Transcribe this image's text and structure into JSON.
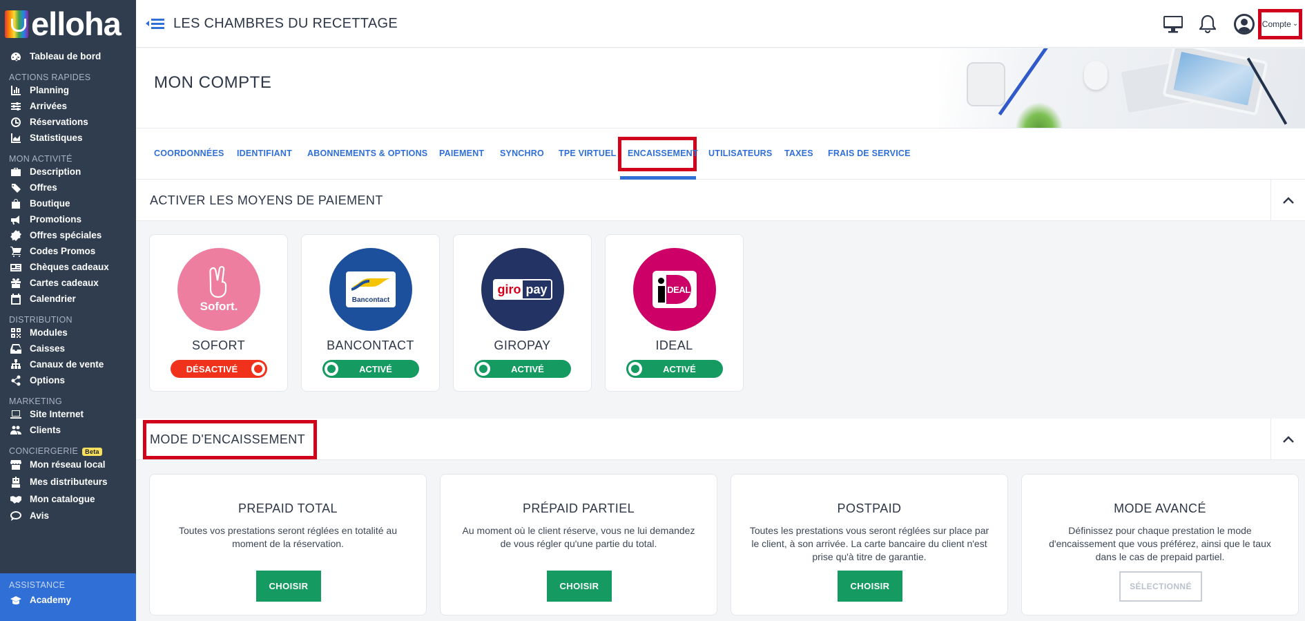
{
  "brand": {
    "logo_text": "elloha"
  },
  "topbar": {
    "hotel_name": "LES CHAMBRES DU RECETTAGE",
    "account_label": "Compte"
  },
  "sidebar": {
    "dashboard": "Tableau de bord",
    "sections": [
      {
        "title": "ACTIONS RAPIDES",
        "items": [
          {
            "label": "Planning",
            "icon": "bar-chart-icon"
          },
          {
            "label": "Arrivées",
            "icon": "sliders-icon"
          },
          {
            "label": "Réservations",
            "icon": "clock-icon"
          },
          {
            "label": "Statistiques",
            "icon": "area-chart-icon"
          }
        ]
      },
      {
        "title": "MON ACTIVITÉ",
        "items": [
          {
            "label": "Description",
            "icon": "briefcase-icon"
          },
          {
            "label": "Offres",
            "icon": "tags-icon"
          },
          {
            "label": "Boutique",
            "icon": "shopping-bag-icon"
          },
          {
            "label": "Promotions",
            "icon": "megaphone-icon"
          },
          {
            "label": "Offres spéciales",
            "icon": "badge-icon"
          },
          {
            "label": "Codes Promos",
            "icon": "cart-icon"
          },
          {
            "label": "Chèques cadeaux",
            "icon": "newspaper-icon"
          },
          {
            "label": "Cartes cadeaux",
            "icon": "gift-icon"
          },
          {
            "label": "Calendrier",
            "icon": "calendar-icon"
          }
        ]
      },
      {
        "title": "DISTRIBUTION",
        "items": [
          {
            "label": "Modules",
            "icon": "qrcode-icon"
          },
          {
            "label": "Caisses",
            "icon": "inbox-icon"
          },
          {
            "label": "Canaux de vente",
            "icon": "sitemap-icon"
          },
          {
            "label": "Options",
            "icon": "share-icon"
          }
        ]
      },
      {
        "title": "MARKETING",
        "items": [
          {
            "label": "Site Internet",
            "icon": "laptop-icon"
          },
          {
            "label": "Clients",
            "icon": "users-icon"
          }
        ]
      },
      {
        "title": "CONCIERGERIE",
        "badge": "Beta",
        "items": [
          {
            "label": "Mon réseau local",
            "icon": "store-icon"
          },
          {
            "label": "Mes distributeurs",
            "icon": "robot-icon"
          },
          {
            "label": "Mon catalogue",
            "icon": "handshake-icon"
          },
          {
            "label": "Avis",
            "icon": "comment-icon"
          }
        ]
      }
    ],
    "assistance": {
      "title": "ASSISTANCE",
      "item": "Academy"
    }
  },
  "page": {
    "title": "MON COMPTE"
  },
  "tabs": [
    "COORDONNÉES",
    "IDENTIFIANT",
    "ABONNEMENTS & OPTIONS",
    "PAIEMENT",
    "SYNCHRO",
    "TPE VIRTUEL",
    "ENCAISSEMENT",
    "UTILISATEURS",
    "TAXES",
    "FRAIS DE SERVICE"
  ],
  "active_tab": "ENCAISSEMENT",
  "payment_section": {
    "title": "ACTIVER LES MOYENS DE PAIEMENT",
    "methods": [
      {
        "name": "SOFORT",
        "logo_text": "Sofort.",
        "status": "DÉSACTIVÉ",
        "enabled": false,
        "color": "#ee7ea0"
      },
      {
        "name": "BANCONTACT",
        "logo_text": "Bancontact",
        "status": "ACTIVÉ",
        "enabled": true,
        "color": "#1c4f9c"
      },
      {
        "name": "GIROPAY",
        "logo_text_a": "giro",
        "logo_text_b": "pay",
        "status": "ACTIVÉ",
        "enabled": true,
        "color": "#233464"
      },
      {
        "name": "IDEAL",
        "logo_text": "DEAL",
        "status": "ACTIVÉ",
        "enabled": true,
        "color": "#cc0066"
      }
    ]
  },
  "mode_section": {
    "title": "MODE D'ENCAISSEMENT",
    "modes": [
      {
        "title": "PREPAID TOTAL",
        "description": "Toutes vos prestations seront réglées en totalité au moment de la réservation.",
        "button": "CHOISIR",
        "selected": false
      },
      {
        "title": "PRÉPAID PARTIEL",
        "description": "Au moment où le client réserve, vous ne lui demandez de vous régler qu'une partie du total.",
        "button": "CHOISIR",
        "selected": false
      },
      {
        "title": "POSTPAID",
        "description": "Toutes les prestations vous seront réglées sur place par le client, à son arrivée. La carte bancaire du client n'est prise qu'à titre de garantie.",
        "button": "CHOISIR",
        "selected": false
      },
      {
        "title": "MODE AVANCÉ",
        "description": "Définissez pour chaque prestation le mode d'encaissement que vous préférez, ainsi que le taux dans le cas de prepaid partiel.",
        "button": "SÉLECTIONNÉ",
        "selected": true
      }
    ]
  },
  "colors": {
    "sidebar_bg": "#2f3d4f",
    "accent_blue": "#2f6fd6",
    "green": "#159a62",
    "red": "#f0321c",
    "highlight_red": "#d0021b"
  }
}
